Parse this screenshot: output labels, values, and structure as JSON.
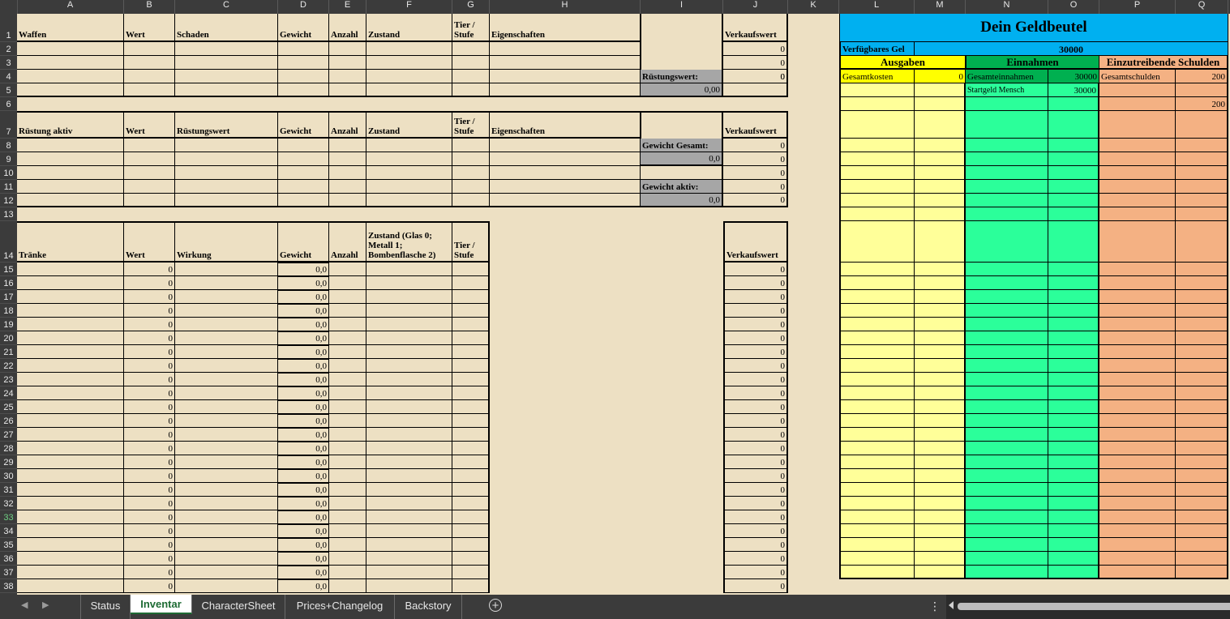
{
  "columns": [
    "A",
    "B",
    "C",
    "D",
    "E",
    "F",
    "G",
    "H",
    "I",
    "J",
    "K",
    "L",
    "M",
    "N",
    "O",
    "P",
    "Q"
  ],
  "rows": [
    1,
    2,
    3,
    4,
    5,
    6,
    7,
    8,
    9,
    10,
    11,
    12,
    13,
    14,
    15,
    16,
    17,
    18,
    19,
    20,
    21,
    22,
    23,
    24,
    25,
    26,
    27,
    28,
    29,
    30,
    31,
    32,
    33,
    34,
    35,
    36,
    37,
    38
  ],
  "selected_row": 33,
  "colors": {
    "parchment": "#ede0c3",
    "gray_label": "#a6a6a6",
    "cyan": "#00b0f0",
    "yellow": "#ffff00",
    "light_yellow": "#ffff99",
    "green": "#00b050",
    "light_green": "#2bff9a",
    "salmon": "#f4b183"
  },
  "weapons": {
    "headers": {
      "name": "Waffen",
      "wert": "Wert",
      "schaden": "Schaden",
      "gewicht": "Gewicht",
      "anzahl": "Anzahl",
      "zustand": "Zustand",
      "tier": "Tier / Stufe",
      "eigenschaften": "Eigenschaften",
      "verkauf": "Verkaufswert"
    },
    "sale_values": [
      "0",
      "0",
      "0"
    ]
  },
  "ruestung_label": "Rüstungswert:",
  "ruestung_value": "0,00",
  "armor": {
    "headers": {
      "name": "Rüstung aktiv",
      "wert": "Wert",
      "ruestungswert": "Rüstungswert",
      "gewicht": "Gewicht",
      "anzahl": "Anzahl",
      "zustand": "Zustand",
      "tier": "Tier / Stufe",
      "eigenschaften": "Eigenschaften",
      "verkauf": "Verkaufswert"
    },
    "sale_values": [
      "0",
      "0",
      "0",
      "0",
      "0"
    ]
  },
  "weight_total_label": "Gewicht Gesamt:",
  "weight_total_value": "0,0",
  "weight_active_label": "Gewicht aktiv:",
  "weight_active_value": "0,0",
  "potions": {
    "headers": {
      "name": "Tränke",
      "wert": "Wert",
      "wirkung": "Wirkung",
      "gewicht": "Gewicht",
      "anzahl": "Anzahl",
      "zustand": "Zustand (Glas 0; Metall 1; Bombenflasche 2)",
      "tier": "Tier / Stufe",
      "verkauf": "Verkaufswert"
    },
    "wert_values": [
      "0",
      "0",
      "0",
      "0",
      "0",
      "0",
      "0",
      "0",
      "0",
      "0",
      "0",
      "0",
      "0",
      "0",
      "0",
      "0",
      "0",
      "0",
      "0",
      "0",
      "0",
      "0",
      "0",
      "0"
    ],
    "gewicht_values": [
      "0,0",
      "0,0",
      "0,0",
      "0,0",
      "0,0",
      "0,0",
      "0,0",
      "0,0",
      "0,0",
      "0,0",
      "0,0",
      "0,0",
      "0,0",
      "0,0",
      "0,0",
      "0,0",
      "0,0",
      "0,0",
      "0,0",
      "0,0",
      "0,0",
      "0,0",
      "0,0",
      "0,0"
    ],
    "sale_values": [
      "0",
      "0",
      "0",
      "0",
      "0",
      "0",
      "0",
      "0",
      "0",
      "0",
      "0",
      "0",
      "0",
      "0",
      "0",
      "0",
      "0",
      "0",
      "0",
      "0",
      "0",
      "0",
      "0",
      "0"
    ]
  },
  "purse": {
    "title": "Dein Geldbeutel",
    "available_label": "Verfügbares Gel",
    "available_value": "30000",
    "expenses_header": "Ausgaben",
    "income_header": "Einnahmen",
    "debts_header": "Einzutreibende Schulden",
    "total_costs_label": "Gesamtkosten",
    "total_costs_value": "0",
    "total_income_label": "Gesamteinnahmen",
    "total_income_value": "30000",
    "total_debts_label": "Gesamtschulden",
    "total_debts_value": "200",
    "income_item_label": "Startgeld Mensch",
    "income_item_value": "30000",
    "debt_item_value": "200"
  },
  "sheet_tabs": {
    "tabs": [
      {
        "label": "Status",
        "active": false
      },
      {
        "label": "Inventar",
        "active": true
      },
      {
        "label": "CharacterSheet",
        "active": false
      },
      {
        "label": "Prices+Changelog",
        "active": false
      },
      {
        "label": "Backstory",
        "active": false
      }
    ],
    "add_label": "+",
    "more_label": "⋮"
  }
}
